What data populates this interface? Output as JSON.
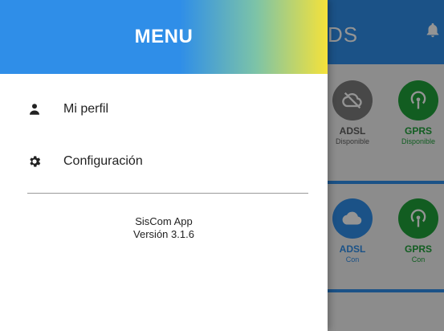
{
  "drawer": {
    "title": "MENU",
    "items": [
      {
        "label": "Mi perfil",
        "icon": "person-icon"
      },
      {
        "label": "Configuración",
        "icon": "gear-icon"
      }
    ],
    "app_name": "SisCom App",
    "version": "Versión 3.1.6"
  },
  "background": {
    "title_fragment": "DS",
    "tiles": [
      {
        "label": "ADSL",
        "sub": "Disponible",
        "style": "gray"
      },
      {
        "label": "GPRS",
        "sub": "Disponible",
        "style": "green"
      },
      {
        "label": "ADSL",
        "sub": "Con",
        "style": "blue"
      },
      {
        "label": "GPRS",
        "sub": "Con",
        "style": "green"
      }
    ]
  },
  "colors": {
    "primary": "#2f8ee8",
    "accent_yellow": "#f5e23a",
    "green": "#1fa13a",
    "gray": "#7c7c7c"
  }
}
